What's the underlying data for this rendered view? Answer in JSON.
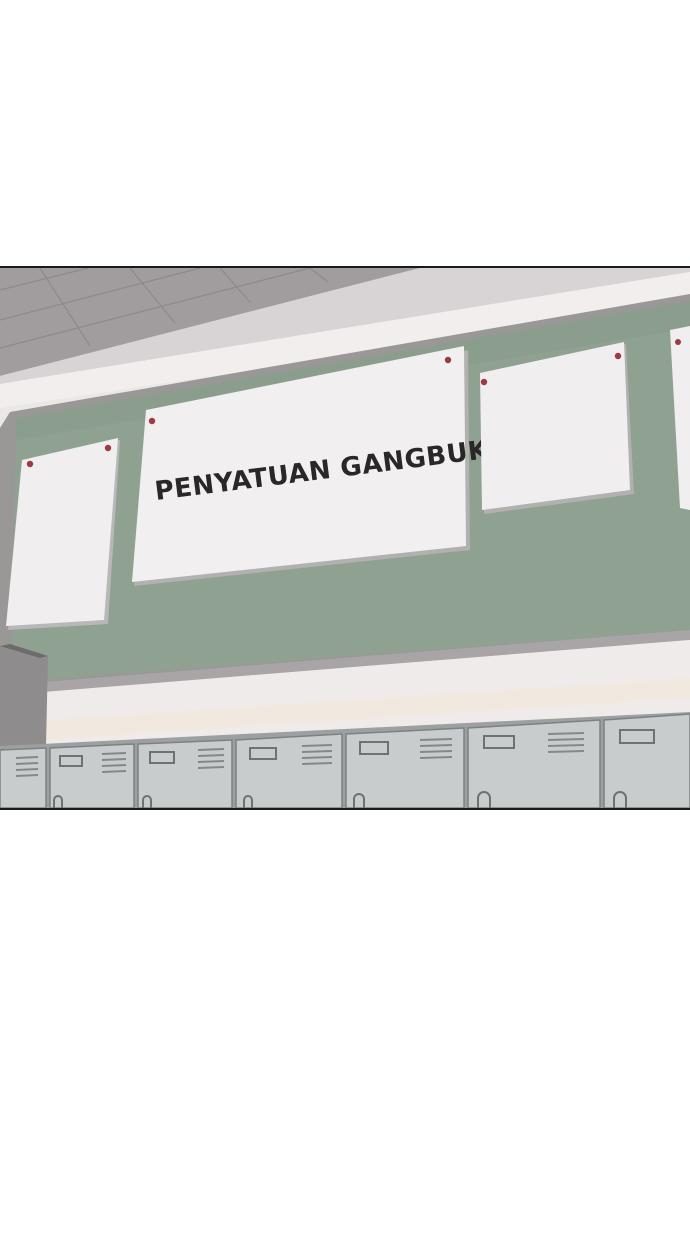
{
  "panel": {
    "sign_text": "PENYATUAN GANGBUK"
  },
  "colors": {
    "board": "#8fa291",
    "wall": "#ece8e8",
    "ceiling": "#9f9b9c",
    "locker": "#c9cccd",
    "border": "#1a1a1a",
    "pin": "#9b3a45"
  }
}
